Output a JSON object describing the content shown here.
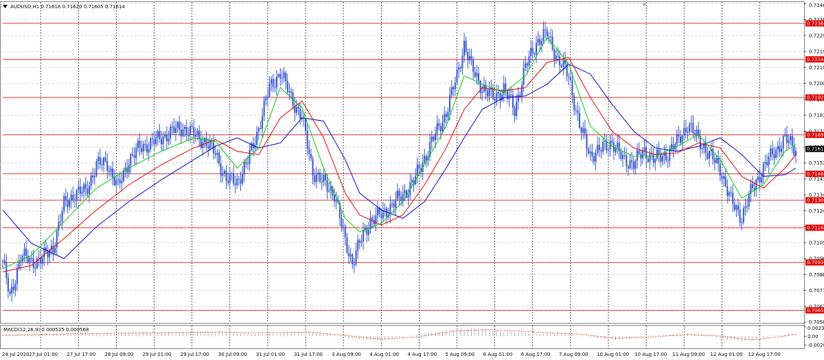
{
  "window": {
    "symbol_title": "AUDUSD,H1  0.71616 0.71620 0.71605 0.71614"
  },
  "colors": {
    "candle": "#3355cc",
    "ma_fast": "#00cc00",
    "ma_mid": "#e00000",
    "ma_slow": "#0000cc",
    "level_line": "#e03030",
    "grid": "#c0c0c0",
    "price_label_bg": "#e00000",
    "current_price_bg": "#000000",
    "macd_hist": "#b0b0b0",
    "macd_signal": "#e03030"
  },
  "chart_data": [
    {
      "type": "candlestick",
      "symbol": "AUDUSD",
      "timeframe": "H1",
      "ohlc_header": {
        "open": 0.71616,
        "high": 0.7162,
        "low": 0.71605,
        "close": 0.71614
      },
      "ylim": [
        0.7058,
        0.7249
      ],
      "y_tick_labels": [
        "0.72480",
        "0.72385",
        "0.72290",
        "0.72195",
        "0.72100",
        "0.72005",
        "0.71910",
        "0.71815",
        "0.71720",
        "0.71625",
        "0.71530",
        "0.71435",
        "0.71340",
        "0.71245",
        "0.71150",
        "0.71055",
        "0.70960",
        "0.70865",
        "0.70770",
        "0.70675",
        "0.70580"
      ],
      "x_tick_labels": [
        "24 Jul 2020",
        "27 Jul 01:00",
        "27 Jul 17:00",
        "28 Jul 09:00",
        "29 Jul 01:00",
        "29 Jul 17:00",
        "30 Jul 09:00",
        "31 Jul 01:00",
        "31 Jul 17:00",
        "3 Aug 09:00",
        "4 Aug 01:00",
        "4 Aug 17:00",
        "5 Aug 09:00",
        "6 Aug 01:00",
        "6 Aug 17:00",
        "7 Aug 09:00",
        "10 Aug 01:00",
        "10 Aug 17:00",
        "11 Aug 09:00",
        "12 Aug 01:00",
        "12 Aug 17:00"
      ],
      "horizontal_levels": [
        "0.72363",
        "0.72148",
        "0.71921",
        "0.71698",
        "0.71466",
        "0.71308",
        "0.71144",
        "0.70937",
        "0.70651"
      ],
      "current_price": "0.71614",
      "close_path": [
        [
          0,
          0.7095
        ],
        [
          4,
          0.7072
        ],
        [
          10,
          0.7098
        ],
        [
          16,
          0.7094
        ],
        [
          22,
          0.7096
        ],
        [
          28,
          0.7103
        ],
        [
          34,
          0.7128
        ],
        [
          40,
          0.7135
        ],
        [
          46,
          0.7136
        ],
        [
          52,
          0.7152
        ],
        [
          58,
          0.7153
        ],
        [
          64,
          0.7138
        ],
        [
          70,
          0.7155
        ],
        [
          76,
          0.7162
        ],
        [
          82,
          0.7165
        ],
        [
          88,
          0.7168
        ],
        [
          94,
          0.7172
        ],
        [
          100,
          0.7174
        ],
        [
          106,
          0.717
        ],
        [
          112,
          0.7166
        ],
        [
          118,
          0.7159
        ],
        [
          124,
          0.7143
        ],
        [
          130,
          0.7142
        ],
        [
          136,
          0.7154
        ],
        [
          142,
          0.7174
        ],
        [
          148,
          0.7198
        ],
        [
          154,
          0.7207
        ],
        [
          160,
          0.7192
        ],
        [
          166,
          0.718
        ],
        [
          172,
          0.7148
        ],
        [
          178,
          0.7141
        ],
        [
          184,
          0.7135
        ],
        [
          190,
          0.7106
        ],
        [
          194,
          0.7094
        ],
        [
          198,
          0.7105
        ],
        [
          204,
          0.7119
        ],
        [
          210,
          0.7122
        ],
        [
          216,
          0.7128
        ],
        [
          222,
          0.7134
        ],
        [
          228,
          0.7142
        ],
        [
          234,
          0.7156
        ],
        [
          240,
          0.717
        ],
        [
          246,
          0.7183
        ],
        [
          252,
          0.7205
        ],
        [
          256,
          0.7224
        ],
        [
          260,
          0.721
        ],
        [
          266,
          0.7198
        ],
        [
          272,
          0.7192
        ],
        [
          278,
          0.7197
        ],
        [
          284,
          0.7185
        ],
        [
          290,
          0.721
        ],
        [
          296,
          0.7225
        ],
        [
          302,
          0.723
        ],
        [
          308,
          0.7215
        ],
        [
          314,
          0.7205
        ],
        [
          320,
          0.7175
        ],
        [
          326,
          0.7158
        ],
        [
          332,
          0.7161
        ],
        [
          338,
          0.7166
        ],
        [
          344,
          0.7155
        ],
        [
          350,
          0.7153
        ],
        [
          356,
          0.716
        ],
        [
          362,
          0.7155
        ],
        [
          368,
          0.7158
        ],
        [
          374,
          0.7165
        ],
        [
          380,
          0.7176
        ],
        [
          386,
          0.7167
        ],
        [
          392,
          0.7158
        ],
        [
          398,
          0.715
        ],
        [
          404,
          0.713
        ],
        [
          410,
          0.7121
        ],
        [
          416,
          0.7138
        ],
        [
          422,
          0.715
        ],
        [
          428,
          0.716
        ],
        [
          434,
          0.7167
        ],
        [
          438,
          0.7164
        ],
        [
          440,
          0.7161
        ]
      ],
      "ma_fast_path": [
        [
          0,
          0.709
        ],
        [
          16,
          0.7098
        ],
        [
          34,
          0.7118
        ],
        [
          52,
          0.7138
        ],
        [
          70,
          0.715
        ],
        [
          88,
          0.716
        ],
        [
          106,
          0.7168
        ],
        [
          118,
          0.7166
        ],
        [
          130,
          0.715
        ],
        [
          142,
          0.7162
        ],
        [
          154,
          0.7198
        ],
        [
          166,
          0.7186
        ],
        [
          178,
          0.715
        ],
        [
          190,
          0.712
        ],
        [
          198,
          0.7112
        ],
        [
          210,
          0.7117
        ],
        [
          222,
          0.713
        ],
        [
          234,
          0.7152
        ],
        [
          246,
          0.7175
        ],
        [
          256,
          0.7205
        ],
        [
          266,
          0.72
        ],
        [
          278,
          0.7195
        ],
        [
          290,
          0.7205
        ],
        [
          302,
          0.7228
        ],
        [
          314,
          0.7212
        ],
        [
          326,
          0.7175
        ],
        [
          338,
          0.7163
        ],
        [
          350,
          0.7157
        ],
        [
          362,
          0.7157
        ],
        [
          374,
          0.7163
        ],
        [
          386,
          0.717
        ],
        [
          398,
          0.7155
        ],
        [
          410,
          0.7132
        ],
        [
          422,
          0.714
        ],
        [
          434,
          0.716
        ],
        [
          440,
          0.7164
        ]
      ],
      "ma_mid_path": [
        [
          0,
          0.7088
        ],
        [
          16,
          0.7092
        ],
        [
          34,
          0.7108
        ],
        [
          52,
          0.7125
        ],
        [
          70,
          0.714
        ],
        [
          88,
          0.7152
        ],
        [
          106,
          0.7162
        ],
        [
          118,
          0.7167
        ],
        [
          130,
          0.716
        ],
        [
          142,
          0.7158
        ],
        [
          154,
          0.718
        ],
        [
          166,
          0.719
        ],
        [
          178,
          0.7168
        ],
        [
          190,
          0.7135
        ],
        [
          198,
          0.7122
        ],
        [
          210,
          0.7116
        ],
        [
          222,
          0.7122
        ],
        [
          234,
          0.714
        ],
        [
          246,
          0.7162
        ],
        [
          256,
          0.7185
        ],
        [
          266,
          0.7198
        ],
        [
          278,
          0.7196
        ],
        [
          290,
          0.7198
        ],
        [
          302,
          0.7213
        ],
        [
          314,
          0.7216
        ],
        [
          326,
          0.7192
        ],
        [
          338,
          0.7172
        ],
        [
          350,
          0.7162
        ],
        [
          362,
          0.7158
        ],
        [
          374,
          0.7159
        ],
        [
          386,
          0.7165
        ],
        [
          398,
          0.7162
        ],
        [
          410,
          0.7145
        ],
        [
          422,
          0.7138
        ],
        [
          434,
          0.715
        ],
        [
          440,
          0.7158
        ]
      ],
      "ma_slow_path": [
        [
          0,
          0.7125
        ],
        [
          16,
          0.7105
        ],
        [
          34,
          0.7096
        ],
        [
          52,
          0.7115
        ],
        [
          70,
          0.713
        ],
        [
          88,
          0.7143
        ],
        [
          106,
          0.7155
        ],
        [
          118,
          0.7163
        ],
        [
          130,
          0.7168
        ],
        [
          142,
          0.7162
        ],
        [
          154,
          0.7165
        ],
        [
          166,
          0.718
        ],
        [
          178,
          0.7178
        ],
        [
          190,
          0.7155
        ],
        [
          198,
          0.7135
        ],
        [
          210,
          0.7125
        ],
        [
          222,
          0.712
        ],
        [
          234,
          0.713
        ],
        [
          246,
          0.715
        ],
        [
          256,
          0.7168
        ],
        [
          266,
          0.7185
        ],
        [
          278,
          0.7192
        ],
        [
          290,
          0.7193
        ],
        [
          302,
          0.72
        ],
        [
          314,
          0.7212
        ],
        [
          326,
          0.7206
        ],
        [
          338,
          0.7188
        ],
        [
          350,
          0.7172
        ],
        [
          362,
          0.7162
        ],
        [
          374,
          0.716
        ],
        [
          386,
          0.7163
        ],
        [
          398,
          0.7168
        ],
        [
          410,
          0.7158
        ],
        [
          422,
          0.7145
        ],
        [
          434,
          0.7146
        ],
        [
          440,
          0.715
        ]
      ]
    },
    {
      "type": "bar",
      "indicator": "MACD",
      "title": "MACD(12,26,9) 0.000525 0.000568",
      "ylim": [
        -0.0029,
        0.0025
      ],
      "y_tick_labels": [
        "0.002315",
        "0.00",
        "-0.00209"
      ],
      "hist_path": [
        [
          0,
          0.0003
        ],
        [
          20,
          0.0005
        ],
        [
          40,
          0.0007
        ],
        [
          60,
          0.0008
        ],
        [
          80,
          0.0009
        ],
        [
          100,
          0.001
        ],
        [
          110,
          0.0011
        ],
        [
          120,
          0.0012
        ],
        [
          130,
          0.0008
        ],
        [
          140,
          0.0005
        ],
        [
          150,
          0.0007
        ],
        [
          160,
          0.0011
        ],
        [
          170,
          0.0012
        ],
        [
          180,
          0.0006
        ],
        [
          190,
          -0.0003
        ],
        [
          200,
          -0.0009
        ],
        [
          210,
          -0.001
        ],
        [
          220,
          -0.0004
        ],
        [
          230,
          0.0004
        ],
        [
          240,
          0.001
        ],
        [
          250,
          0.0016
        ],
        [
          260,
          0.0019
        ],
        [
          270,
          0.0015
        ],
        [
          280,
          0.0011
        ],
        [
          290,
          0.0008
        ],
        [
          300,
          0.0007
        ],
        [
          310,
          0.0006
        ],
        [
          320,
          0.0002
        ],
        [
          330,
          -0.0005
        ],
        [
          340,
          -0.0008
        ],
        [
          350,
          -0.0004
        ],
        [
          360,
          0.0002
        ],
        [
          370,
          0.0004
        ],
        [
          380,
          0.0005
        ],
        [
          390,
          0.0003
        ],
        [
          400,
          -0.0007
        ],
        [
          410,
          -0.0012
        ],
        [
          420,
          -0.0006
        ],
        [
          430,
          0.0003
        ],
        [
          440,
          0.0005
        ]
      ],
      "signal_path": [
        [
          0,
          0.0002
        ],
        [
          40,
          0.0006
        ],
        [
          80,
          0.0008
        ],
        [
          120,
          0.001
        ],
        [
          140,
          0.0008
        ],
        [
          170,
          0.001
        ],
        [
          190,
          0.0002
        ],
        [
          210,
          -0.0007
        ],
        [
          230,
          -0.0002
        ],
        [
          250,
          0.0012
        ],
        [
          270,
          0.0016
        ],
        [
          300,
          0.0009
        ],
        [
          320,
          0.0005
        ],
        [
          340,
          -0.0005
        ],
        [
          360,
          -0.0002
        ],
        [
          380,
          0.0004
        ],
        [
          400,
          0.0
        ],
        [
          415,
          -0.0009
        ],
        [
          430,
          -0.0002
        ],
        [
          440,
          0.0005
        ]
      ]
    }
  ]
}
